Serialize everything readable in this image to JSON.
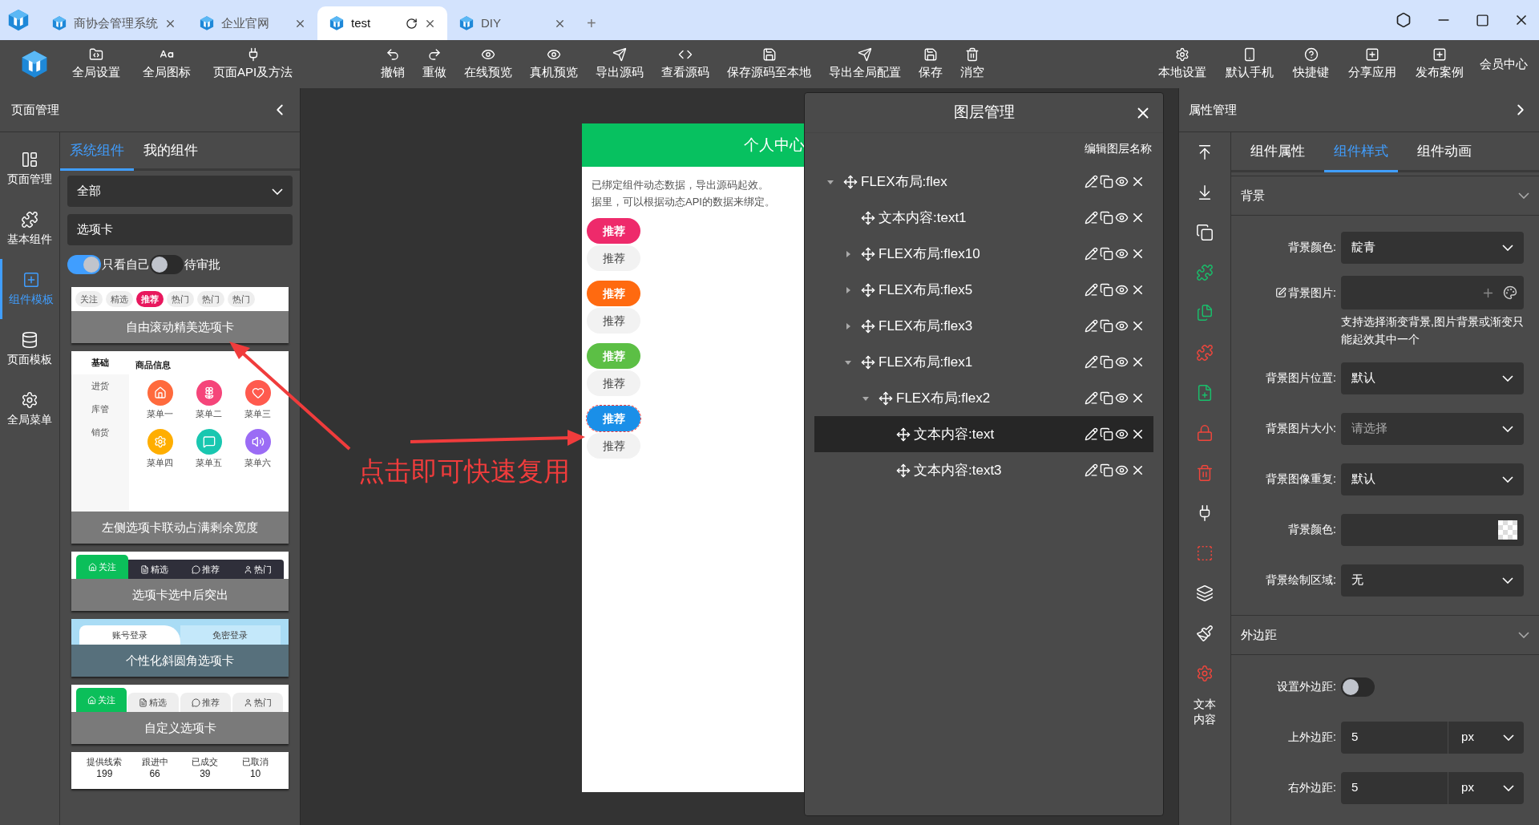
{
  "browser": {
    "tabs": [
      {
        "title": "商协会管理系统",
        "selected": false
      },
      {
        "title": "企业官网",
        "selected": false
      },
      {
        "title": "test",
        "selected": true
      },
      {
        "title": "DIY",
        "selected": false
      }
    ],
    "new_tab": "+"
  },
  "toolbar": {
    "left": [
      "全局设置",
      "全局图标",
      "页面API及方法"
    ],
    "center": [
      "撤销",
      "重做",
      "在线预览",
      "真机预览",
      "导出源码",
      "查看源码",
      "保存源码至本地",
      "导出全局配置",
      "保存",
      "消空"
    ],
    "right": [
      "本地设置",
      "默认手机",
      "快捷键",
      "分享应用",
      "发布案例"
    ],
    "member": "会员中心"
  },
  "left_panel": {
    "title": "页面管理",
    "rail": [
      {
        "label": "页面管理",
        "selected": false
      },
      {
        "label": "基本组件",
        "selected": false
      },
      {
        "label": "组件模板",
        "selected": true
      },
      {
        "label": "页面模板",
        "selected": false
      },
      {
        "label": "全局菜单",
        "selected": false
      }
    ],
    "tabs": [
      {
        "label": "系统组件",
        "selected": true
      },
      {
        "label": "我的组件",
        "selected": false
      }
    ],
    "category": "全部",
    "search": "选项卡",
    "filters": [
      {
        "label": "只看自己",
        "on": true
      },
      {
        "label": "待审批",
        "on": false
      }
    ],
    "templates": [
      {
        "caption": "自由滚动精美选项卡",
        "preview": {
          "kind": "pills",
          "items": [
            {
              "label": "关注",
              "selected": false
            },
            {
              "label": "精选",
              "selected": false
            },
            {
              "label": "推荐",
              "selected": true
            },
            {
              "label": "热门",
              "selected": false
            },
            {
              "label": "热门",
              "selected": false
            },
            {
              "label": "热门",
              "selected": false
            }
          ]
        }
      },
      {
        "caption": "左侧选项卡联动占满剩余宽度",
        "preview": {
          "kind": "side_grid",
          "side": [
            {
              "label": "基础",
              "selected": true
            },
            {
              "label": "进货",
              "selected": false
            },
            {
              "label": "库管",
              "selected": false
            },
            {
              "label": "销货",
              "selected": false
            }
          ],
          "heading": "商品信息",
          "menu": [
            {
              "label": "菜单一",
              "color": "#ff6a3d"
            },
            {
              "label": "菜单二",
              "color": "#f5457a"
            },
            {
              "label": "菜单三",
              "color": "#ff5a4e"
            },
            {
              "label": "菜单四",
              "color": "#ffae00"
            },
            {
              "label": "菜单五",
              "color": "#19c7b0"
            },
            {
              "label": "菜单六",
              "color": "#9b6cf5"
            }
          ]
        }
      },
      {
        "caption": "选项卡选中后突出",
        "preview": {
          "kind": "dark_tabs",
          "items": [
            {
              "label": "关注",
              "selected": true
            },
            {
              "label": "精选",
              "selected": false
            },
            {
              "label": "推荐",
              "selected": false
            },
            {
              "label": "热门",
              "selected": false
            }
          ]
        }
      },
      {
        "caption": "个性化斜圆角选项卡",
        "preview": {
          "kind": "slant_tabs",
          "items": [
            {
              "label": "账号登录",
              "selected": true
            },
            {
              "label": "免密登录",
              "selected": false
            }
          ]
        }
      },
      {
        "caption": "自定义选项卡",
        "preview": {
          "kind": "round_tabs",
          "items": [
            {
              "label": "关注",
              "selected": true
            },
            {
              "label": "精选",
              "selected": false
            },
            {
              "label": "推荐",
              "selected": false
            },
            {
              "label": "热门",
              "selected": false
            }
          ]
        }
      },
      {
        "preview": {
          "kind": "stats",
          "items": [
            {
              "label": "提供线索",
              "value": "199"
            },
            {
              "label": "跟进中",
              "value": "66"
            },
            {
              "label": "已成交",
              "value": "39"
            },
            {
              "label": "已取消",
              "value": "10"
            }
          ]
        }
      }
    ]
  },
  "canvas": {
    "phone": {
      "title": "个人中心",
      "notice": [
        "已绑定组件动态数据，导出源码起效。",
        "据里，可以根据动态API的数据来绑定。"
      ],
      "tags": [
        {
          "label": "推荐",
          "secondary": "推荐",
          "color": "#ee2a6b",
          "selected": false
        },
        {
          "label": "推荐",
          "secondary": "推荐",
          "color": "#ff6a10",
          "selected": false
        },
        {
          "label": "推荐",
          "secondary": "推荐",
          "color": "#5cbf45",
          "selected": false
        },
        {
          "label": "推荐",
          "secondary": "推荐",
          "color": "#1a8fe8",
          "selected": true
        }
      ]
    }
  },
  "annotation": {
    "text": "点击即可快速复用"
  },
  "layer_panel": {
    "title": "图层管理",
    "rename": "编辑图层名称",
    "layers": [
      {
        "kind": "group",
        "label": "FLEX布局:flex",
        "expanded": true,
        "selected": false,
        "children": [
          {
            "kind": "leaf",
            "label": "文本内容:text1",
            "selected": false
          },
          {
            "kind": "group",
            "label": "FLEX布局:flex10",
            "expanded": false,
            "selected": false
          },
          {
            "kind": "group",
            "label": "FLEX布局:flex5",
            "expanded": false,
            "selected": false
          },
          {
            "kind": "group",
            "label": "FLEX布局:flex3",
            "expanded": false,
            "selected": false
          },
          {
            "kind": "group",
            "label": "FLEX布局:flex1",
            "expanded": true,
            "selected": false,
            "children": [
              {
                "kind": "group",
                "label": "FLEX布局:flex2",
                "expanded": true,
                "selected": false,
                "children": [
                  {
                    "kind": "leaf",
                    "label": "文本内容:text",
                    "selected": true
                  },
                  {
                    "kind": "leaf",
                    "label": "文本内容:text3",
                    "selected": false
                  }
                ]
              }
            ]
          }
        ]
      }
    ]
  },
  "right_panel": {
    "title": "属性管理",
    "actions_label": "文本内容",
    "tabs": [
      {
        "label": "组件属性",
        "selected": false
      },
      {
        "label": "组件样式",
        "selected": true
      },
      {
        "label": "组件动画",
        "selected": false
      }
    ],
    "sections": [
      {
        "title": "背景",
        "expanded": true,
        "rows": [
          {
            "kind": "select",
            "label": "背景颜色:",
            "value": "靛青"
          },
          {
            "kind": "image",
            "label": "背景图片:",
            "hint": "支持选择渐变背景,图片背景或渐变只能起效其中一个"
          },
          {
            "kind": "select",
            "label": "背景图片位置:",
            "value": "默认"
          },
          {
            "kind": "select",
            "label": "背景图片大小:",
            "placeholder": "请选择"
          },
          {
            "kind": "select",
            "label": "背景图像重复:",
            "value": "默认"
          },
          {
            "kind": "color",
            "label": "背景颜色:"
          },
          {
            "kind": "select",
            "label": "背景绘制区域:",
            "value": "无"
          }
        ]
      },
      {
        "title": "外边距",
        "expanded": true,
        "rows": [
          {
            "kind": "toggle",
            "label": "设置外边距:",
            "on": false
          },
          {
            "kind": "unit",
            "label": "上外边距:",
            "value": "5",
            "unit": "px"
          },
          {
            "kind": "unit",
            "label": "右外边距:",
            "value": "5",
            "unit": "px"
          }
        ]
      }
    ]
  }
}
